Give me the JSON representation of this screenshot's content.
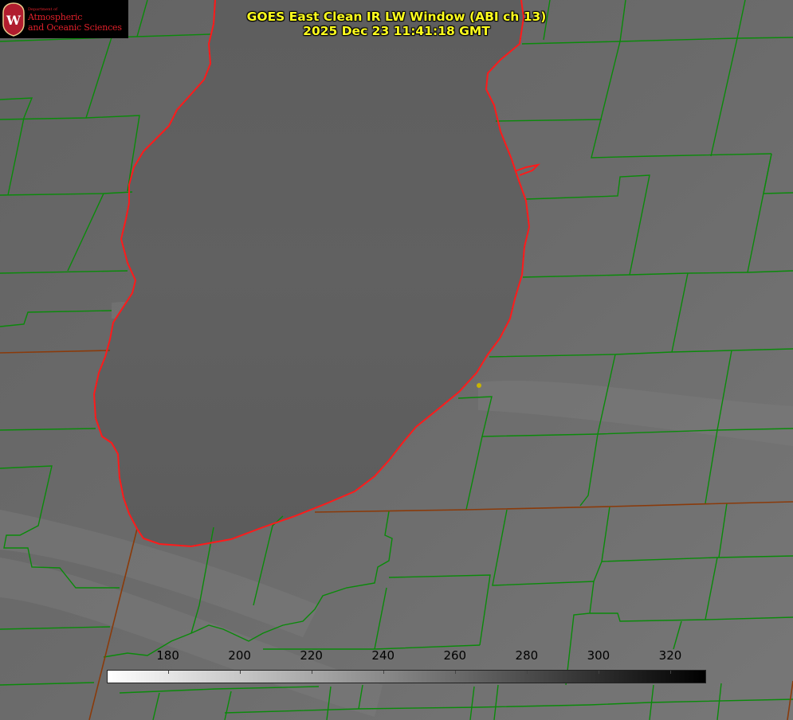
{
  "title": {
    "line1": "GOES East Clean IR LW Window (ABI ch 13)",
    "line2": "2025 Dec 23 11:41:18 GMT"
  },
  "logo": {
    "dept": "Department of",
    "line1": "Atmospheric",
    "line2": "and Oceanic Sciences",
    "crest_letter": "W",
    "crest_color": "#b01c2e",
    "text_color": "#e0202a"
  },
  "colorbar": {
    "ticks": [
      "180",
      "200",
      "220",
      "240",
      "260",
      "280",
      "300",
      "320"
    ],
    "tick_values": [
      180,
      200,
      220,
      240,
      260,
      280,
      300,
      320
    ],
    "min": 163,
    "max": 330,
    "colors": {
      "low": "#ffffff",
      "high": "#000000"
    }
  },
  "map": {
    "county_line_color": "#0a8a0a",
    "state_line_color": "#7a4a10",
    "coastline_color": "#ff1a1a",
    "marker_color": "#c8b400"
  }
}
